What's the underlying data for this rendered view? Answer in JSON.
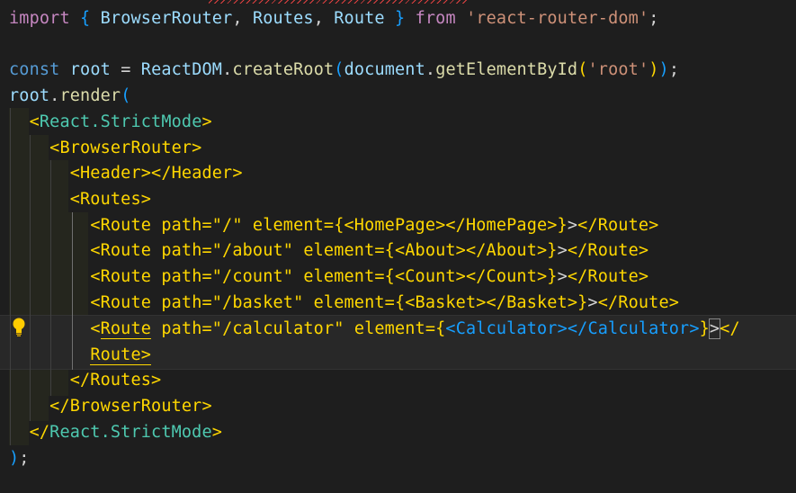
{
  "editor": {
    "lines": [
      {
        "tokens": [
          {
            "t": "import",
            "c": "kw"
          },
          {
            "t": " ",
            "c": "txt"
          },
          {
            "t": "{",
            "c": "b3"
          },
          {
            "t": " ",
            "c": "txt"
          },
          {
            "t": "BrowserRouter",
            "c": "var"
          },
          {
            "t": ", ",
            "c": "txt"
          },
          {
            "t": "Routes",
            "c": "var"
          },
          {
            "t": ", ",
            "c": "txt"
          },
          {
            "t": "Route",
            "c": "var"
          },
          {
            "t": " ",
            "c": "txt"
          },
          {
            "t": "}",
            "c": "b3"
          },
          {
            "t": " ",
            "c": "txt"
          },
          {
            "t": "from",
            "c": "kw"
          },
          {
            "t": " ",
            "c": "txt"
          },
          {
            "t": "'react-router-dom'",
            "c": "str"
          },
          {
            "t": ";",
            "c": "txt"
          }
        ]
      },
      {
        "tokens": []
      },
      {
        "tokens": [
          {
            "t": "const",
            "c": "kwb"
          },
          {
            "t": " ",
            "c": "txt"
          },
          {
            "t": "root",
            "c": "var"
          },
          {
            "t": " = ",
            "c": "txt"
          },
          {
            "t": "ReactDOM",
            "c": "var"
          },
          {
            "t": ".",
            "c": "txt"
          },
          {
            "t": "createRoot",
            "c": "fn"
          },
          {
            "t": "(",
            "c": "b3"
          },
          {
            "t": "document",
            "c": "var"
          },
          {
            "t": ".",
            "c": "txt"
          },
          {
            "t": "getElementById",
            "c": "fn"
          },
          {
            "t": "(",
            "c": "b1"
          },
          {
            "t": "'root'",
            "c": "str"
          },
          {
            "t": ")",
            "c": "b1"
          },
          {
            "t": ")",
            "c": "b3"
          },
          {
            "t": ";",
            "c": "txt"
          }
        ]
      },
      {
        "tokens": [
          {
            "t": "root",
            "c": "var"
          },
          {
            "t": ".",
            "c": "txt"
          },
          {
            "t": "render",
            "c": "fn"
          },
          {
            "t": "(",
            "c": "b3"
          }
        ]
      },
      {
        "tokens": [
          {
            "t": "  ",
            "c": "txt"
          },
          {
            "t": "<",
            "c": "tag"
          },
          {
            "t": "React.StrictMode",
            "c": "cls"
          },
          {
            "t": ">",
            "c": "tag"
          }
        ]
      },
      {
        "tokens": [
          {
            "t": "    ",
            "c": "txt"
          },
          {
            "t": "<BrowserRouter>",
            "c": "tag"
          }
        ]
      },
      {
        "tokens": [
          {
            "t": "      ",
            "c": "txt"
          },
          {
            "t": "<Header></Header>",
            "c": "tag"
          }
        ]
      },
      {
        "tokens": [
          {
            "t": "      ",
            "c": "txt"
          },
          {
            "t": "<Routes>",
            "c": "tag"
          }
        ]
      },
      {
        "tokens": [
          {
            "t": "        ",
            "c": "txt"
          },
          {
            "t": "<Route path=\"/\" element={<HomePage></HomePage>}",
            "c": "tag"
          },
          {
            "t": ">",
            "c": "txt"
          },
          {
            "t": "</Route>",
            "c": "tag"
          }
        ]
      },
      {
        "tokens": [
          {
            "t": "        ",
            "c": "txt"
          },
          {
            "t": "<Route path=\"/about\" element={<About></About>}",
            "c": "tag"
          },
          {
            "t": ">",
            "c": "txt"
          },
          {
            "t": "</Route>",
            "c": "tag"
          }
        ]
      },
      {
        "tokens": [
          {
            "t": "        ",
            "c": "txt"
          },
          {
            "t": "<Route path=\"/count\" element={<Count></Count>}",
            "c": "tag"
          },
          {
            "t": ">",
            "c": "txt"
          },
          {
            "t": "</Route>",
            "c": "tag"
          }
        ]
      },
      {
        "tokens": [
          {
            "t": "        ",
            "c": "txt"
          },
          {
            "t": "<Route path=\"/basket\" element={<Basket></Basket>}",
            "c": "tag"
          },
          {
            "t": ">",
            "c": "txt"
          },
          {
            "t": "</Route>",
            "c": "tag"
          }
        ]
      },
      {
        "tokens": [
          {
            "t": "        ",
            "c": "txt"
          },
          {
            "t": "<",
            "c": "tag"
          },
          {
            "t": "Route",
            "c": "tag"
          },
          {
            "t": " path=\"/calculator\" element={",
            "c": "tag"
          },
          {
            "t": "<Calculator></Calculator>",
            "c": "tagb"
          },
          {
            "t": "}",
            "c": "tag"
          },
          {
            "t": ">",
            "c": "txt"
          },
          {
            "t": "</",
            "c": "tag"
          }
        ]
      },
      {
        "tokens": [
          {
            "t": "        ",
            "c": "txt"
          },
          {
            "t": "Route",
            "c": "tag"
          },
          {
            "t": ">",
            "c": "tag"
          }
        ]
      },
      {
        "tokens": [
          {
            "t": "      ",
            "c": "txt"
          },
          {
            "t": "</Routes>",
            "c": "tag"
          }
        ]
      },
      {
        "tokens": [
          {
            "t": "    ",
            "c": "txt"
          },
          {
            "t": "</BrowserRouter>",
            "c": "tag"
          }
        ]
      },
      {
        "tokens": [
          {
            "t": "  ",
            "c": "txt"
          },
          {
            "t": "</",
            "c": "tag"
          },
          {
            "t": "React.StrictMode",
            "c": "cls"
          },
          {
            "t": ">",
            "c": "tag"
          }
        ]
      },
      {
        "tokens": [
          {
            "t": ")",
            "c": "b3"
          },
          {
            "t": ";",
            "c": "txt"
          }
        ]
      }
    ],
    "lightbulb_icon": "lightbulb-icon",
    "colors": {
      "background": "#1e1e1e",
      "keyword": "#c586c0",
      "string": "#ce9178",
      "variable": "#9cdcfe",
      "function": "#dcdcaa",
      "jsx_tag": "#ffd700",
      "component": "#179fff"
    }
  }
}
